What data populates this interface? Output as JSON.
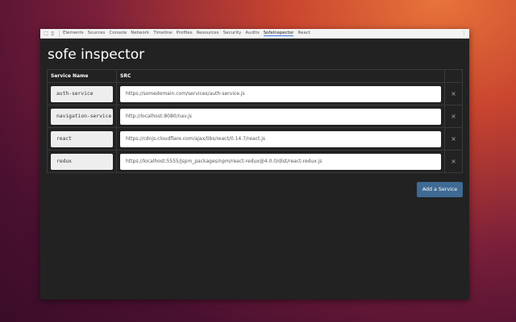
{
  "toolbar": {
    "tabs": [
      "Elements",
      "Sources",
      "Console",
      "Network",
      "Timeline",
      "Profiles",
      "Resources",
      "Security",
      "Audits",
      "SofeInspector",
      "React"
    ],
    "active": "SofeInspector"
  },
  "title": "sofe inspector",
  "table": {
    "headers": [
      "Service Name",
      "SRC"
    ],
    "rows": [
      {
        "name": "auth-service",
        "src": "https://somedomain.com/services/auth-service.js"
      },
      {
        "name": "navigation-service",
        "src": "http://localhost:8080/nav.js"
      },
      {
        "name": "react",
        "src": "https://cdnjs.cloudflare.com/ajax/libs/react/0.14.7/react.js"
      },
      {
        "name": "redux",
        "src": "https://localhost:5555/jspm_packages/npm/react-redux@4.0.0/dist/react-redux.js"
      }
    ]
  },
  "remove_label": "×",
  "add_label": "Add a Service"
}
